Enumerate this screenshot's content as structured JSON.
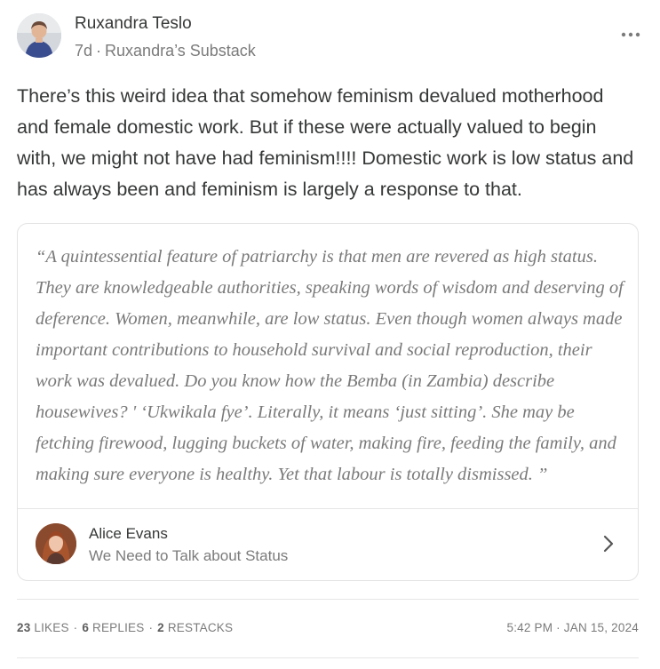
{
  "post": {
    "author": {
      "name": "Ruxandra Teslo",
      "avatar_icon": "person-portrait-icon"
    },
    "meta": {
      "age": "7d",
      "separator": "·",
      "publication": "Ruxandra’s Substack"
    },
    "more_icon": "ellipsis-icon",
    "body": "There’s this weird idea that somehow feminism devalued motherhood and female domestic work. But if these were actually valued to begin with, we might not have had feminism!!!! Domestic work is low status and has always been and feminism is largely a response to that."
  },
  "quote": {
    "text": "“A quintessential feature of patriarchy is that men are revered as high status. They are knowledgeable authorities, speaking words of wisdom and deserving of deference. Women, meanwhile, are low status. Even though women always made important contributions to household survival and social reproduction, their work was devalued. Do you know how the Bemba (in Zambia) describe housewives? ' ‘Ukwikala fye’. Literally, it means ‘just sitting’. She may be fetching firewood, lugging buckets of water, making fire, feeding the family, and making sure everyone is healthy. Yet that labour is totally dismissed. ”",
    "source": {
      "author": "Alice Evans",
      "publication": "We Need to Talk about Status",
      "avatar_icon": "person-portrait-icon",
      "chevron_icon": "chevron-right-icon"
    }
  },
  "footer": {
    "likes_count": "23",
    "likes_label": "LIKES",
    "replies_count": "6",
    "replies_label": "REPLIES",
    "restacks_count": "2",
    "restacks_label": "RESTACKS",
    "separator": "·",
    "timestamp": "5:42 PM · JAN 15, 2024"
  },
  "colors": {
    "text_primary": "#363737",
    "text_secondary": "#7b7b7b",
    "quote_text": "#7a7a7a",
    "border": "#e3e3e3",
    "background": "#ffffff"
  }
}
